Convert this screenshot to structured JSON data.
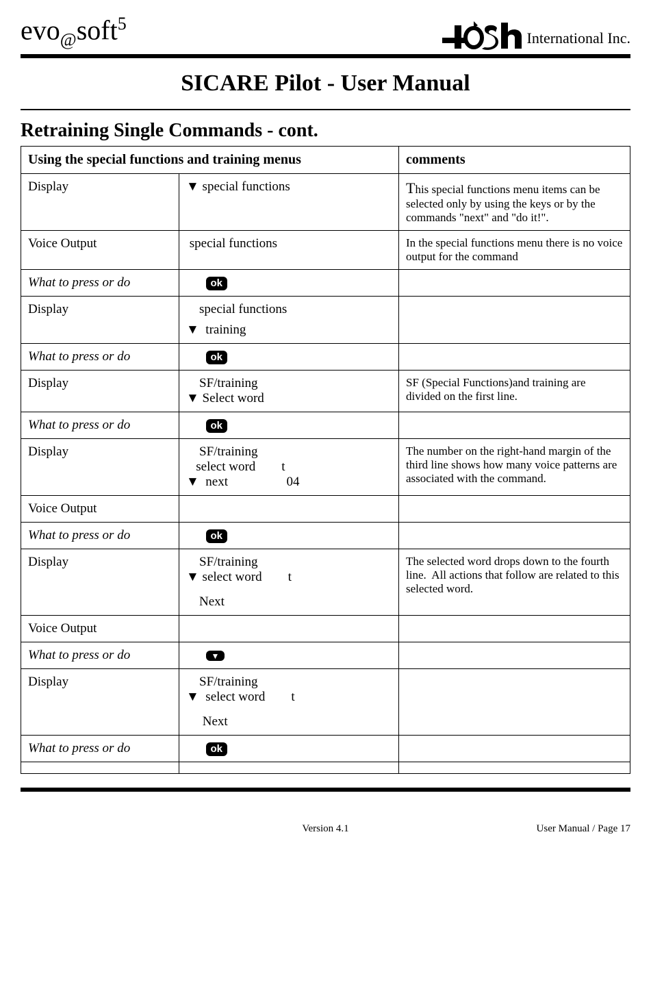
{
  "header": {
    "logo_left_1": "evo",
    "logo_left_at": "@",
    "logo_left_2": "soft",
    "logo_left_sup": "5",
    "logo_right_text": "International Inc."
  },
  "page_title": "SICARE Pilot - User Manual",
  "section_title": "Retraining Single Commands - cont.",
  "table": {
    "header_left": "Using the special functions and training menus",
    "header_right": "comments",
    "rows": [
      {
        "c1": "Display",
        "c2_html": "▼ special functions",
        "c3_html": "<span class='bigT'>T</span>his special functions menu items can be selected only by using the keys or by the commands \"next\" and \"do it!\"."
      },
      {
        "c1": "Voice Output",
        "c2_html": "&nbsp;special functions",
        "c3_html": "In the special functions menu there is no voice output for the command"
      },
      {
        "c1_italic": true,
        "c1": "What to press or do",
        "c2_html": "&nbsp;&nbsp;&nbsp;&nbsp;&nbsp;&nbsp;<span class='ok-btn'>ok</span>",
        "c3_html": ""
      },
      {
        "c1": "Display",
        "c2_html": "&nbsp;&nbsp;&nbsp;&nbsp;special functions<div style='height:8px'></div>▼&nbsp; training",
        "c3_html": ""
      },
      {
        "c1_italic": true,
        "c1": "What to press or do",
        "c2_html": "&nbsp;&nbsp;&nbsp;&nbsp;&nbsp;&nbsp;<span class='ok-btn'>ok</span>",
        "c3_html": ""
      },
      {
        "c1": "Display",
        "c2_html": "&nbsp;&nbsp;&nbsp;&nbsp;SF/training<br>▼ Select word",
        "c3_html": "SF (Special Functions)and training are divided on the first line."
      },
      {
        "c1_italic": true,
        "c1": "What to press or do",
        "c2_html": "&nbsp;&nbsp;&nbsp;&nbsp;&nbsp;&nbsp;<span class='ok-btn'>ok</span>",
        "c3_html": ""
      },
      {
        "c1": "Display",
        "c2_html": "&nbsp;&nbsp;&nbsp;&nbsp;SF/training<br>&nbsp;&nbsp;&nbsp;select word&nbsp;&nbsp;&nbsp;&nbsp;&nbsp;&nbsp;&nbsp;&nbsp;t<br>▼&nbsp; next&nbsp;&nbsp;&nbsp;&nbsp;&nbsp;&nbsp;&nbsp;&nbsp;&nbsp;&nbsp;&nbsp;&nbsp;&nbsp;&nbsp;&nbsp;&nbsp;&nbsp;&nbsp;04",
        "c3_html": "The number on the right-hand margin of the third line shows how many voice patterns are associated with the command."
      },
      {
        "c1": "Voice Output",
        "c2_html": "",
        "c3_html": ""
      },
      {
        "c1_italic": true,
        "c1": "What to press or do",
        "c2_html": "&nbsp;&nbsp;&nbsp;&nbsp;&nbsp;&nbsp;<span class='ok-btn'>ok</span>",
        "c3_html": ""
      },
      {
        "c1": "Display",
        "c2_html": "&nbsp;&nbsp;&nbsp;&nbsp;SF/training<br>▼ select word&nbsp;&nbsp;&nbsp;&nbsp;&nbsp;&nbsp;&nbsp;&nbsp;t<div style='height:14px'></div>&nbsp;&nbsp;&nbsp;&nbsp;Next",
        "c3_html": "The selected word drops down to the fourth line.&nbsp; All actions that follow are related to this selected word."
      },
      {
        "c1": "Voice Output",
        "c2_html": "",
        "c3_html": ""
      },
      {
        "c1_italic": true,
        "c1": "What to press or do",
        "c2_html": "&nbsp;&nbsp;&nbsp;&nbsp;&nbsp;&nbsp;<span class='down-btn'>▼</span>",
        "c3_html": ""
      },
      {
        "c1": "Display",
        "c2_html": "&nbsp;&nbsp;&nbsp;&nbsp;SF/training<br>▼&nbsp; select word&nbsp;&nbsp;&nbsp;&nbsp;&nbsp;&nbsp;&nbsp;&nbsp;t<div style='height:14px'></div>&nbsp;&nbsp;&nbsp;&nbsp;&nbsp;Next",
        "c3_html": ""
      },
      {
        "c1_italic": true,
        "c1": "What to press or do",
        "c2_html": "&nbsp;&nbsp;&nbsp;&nbsp;&nbsp;&nbsp;<span class='ok-btn'>ok</span>",
        "c3_html": ""
      },
      {
        "c1": "",
        "c2_html": "",
        "c3_html": ""
      }
    ]
  },
  "footer": {
    "version": "Version 4.1",
    "page": "User Manual / Page 17"
  }
}
